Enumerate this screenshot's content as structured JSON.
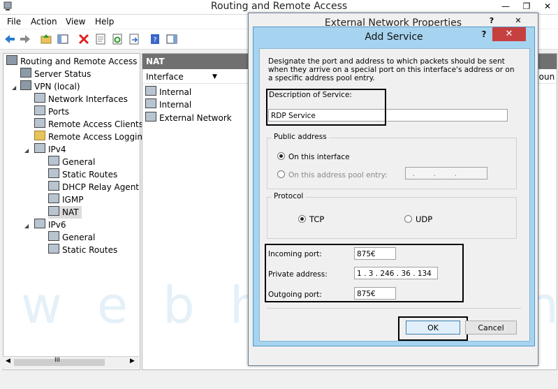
{
  "window": {
    "title": "Routing and Remote Access",
    "min": "—",
    "restore": "❐",
    "close": "✕"
  },
  "menu": [
    "File",
    "Action",
    "View",
    "Help"
  ],
  "tree": {
    "root": "Routing and Remote Access",
    "server_status": "Server Status",
    "vpn": "VPN (local)",
    "network_interfaces": "Network Interfaces",
    "ports": "Ports",
    "remote_access_clients": "Remote Access Clients (",
    "remote_access_logging": "Remote Access Logging",
    "ipv4": "IPv4",
    "ipv4_general": "General",
    "ipv4_static_routes": "Static Routes",
    "dhcp_relay": "DHCP Relay Agent",
    "igmp": "IGMP",
    "nat": "NAT",
    "ipv6": "IPv6",
    "ipv6_general": "General",
    "ipv6_static_routes": "Static Routes"
  },
  "scroll_thumb": "III",
  "right_pane": {
    "header": "NAT",
    "column": "Interface",
    "column_right_partial": "poun",
    "rows": [
      "Internal",
      "Internal",
      "External Network"
    ]
  },
  "ext_dialog": {
    "title": "External Network Properties",
    "help": "?",
    "close": "✕"
  },
  "add_service": {
    "title": "Add Service",
    "help": "?",
    "close": "✕",
    "description": "Designate the port and address to which packets should be sent when they arrive on a special port on this interface's address or on a specific address pool entry.",
    "description_label": "Description of Service:",
    "description_value": "RDP Service",
    "public_address_label": "Public address",
    "on_this_interface": "On this interface",
    "on_pool_entry": "On this address pool entry:",
    "pool_entry_value": "  .        .        .",
    "protocol_label": "Protocol",
    "tcp": "TCP",
    "udp": "UDP",
    "incoming_port_label": "Incoming port:",
    "incoming_port_value": "875€",
    "private_address_label": "Private address:",
    "private_address_value": "1 . 3 . 246 . 36 . 134",
    "outgoing_port_label": "Outgoing port:",
    "outgoing_port_value": "875€",
    "ok": "OK",
    "cancel": "Cancel"
  },
  "watermark": "webhosting",
  "colors": {
    "title_active": "#a6d4f0",
    "close_red": "#c74040",
    "nat_header": "#707070"
  }
}
